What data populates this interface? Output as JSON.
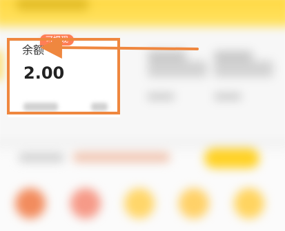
{
  "balance": {
    "label": "余额",
    "amount": "2.00",
    "badge": "可提现"
  },
  "colors": {
    "header_yellow": "#ffd73e",
    "highlight_orange": "#ef873f",
    "badge_orange": "#ff7e55",
    "balance_text": "#222222",
    "label_text": "#333333"
  },
  "icons": {
    "arrow": "pointer-arrow-icon"
  }
}
